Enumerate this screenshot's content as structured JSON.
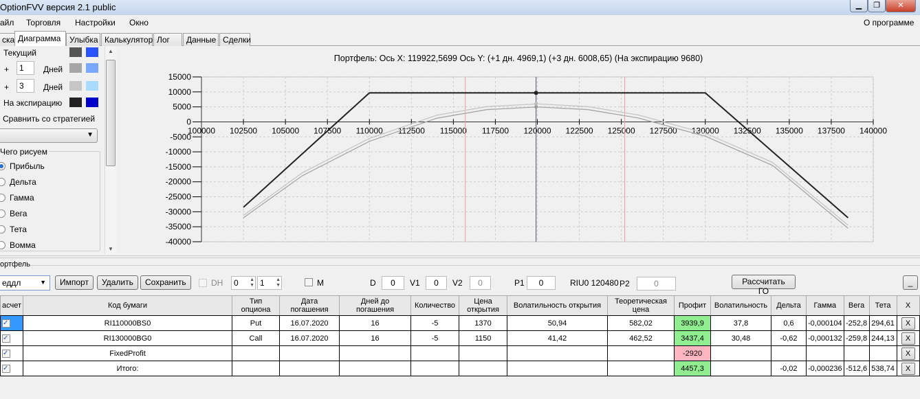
{
  "window": {
    "title": "OptionFVV версия 2.1 public",
    "minimize": "▁",
    "maximize": "❐",
    "close": "✕"
  },
  "menu": {
    "items": [
      "айл",
      "Торговля",
      "Настройки",
      "Окно"
    ],
    "about": "О программе"
  },
  "tabs": [
    "ска",
    "Диаграмма",
    "Улыбка",
    "Калькулятор",
    "Лог",
    "Данные",
    "Сделки"
  ],
  "left": {
    "current": "Текущий",
    "plus": "+",
    "days_label": "Дней",
    "day1": "1",
    "day3": "3",
    "expiry": "На экспирацию",
    "compare": "Сравнить со стратегией",
    "what_draw": "Чего рисуем",
    "radios": [
      "Прибыль",
      "Дельта",
      "Гамма",
      "Вега",
      "Тета",
      "Вомма"
    ],
    "colors": {
      "current": [
        "#555555",
        "#2a52fe"
      ],
      "d1": [
        "#a6a6a6",
        "#7aa8ff"
      ],
      "d3": [
        "#c6c6c6",
        "#a8dcff"
      ],
      "expiry": [
        "#222222",
        "#0000c8"
      ]
    }
  },
  "chart_data": {
    "type": "line",
    "title": "Портфель: Ось X: 119922,5699 Ось Y:  (+1 дн. 4969,1)  (+3 дн. 6008,65)  (На экспирацию 9680)",
    "xlim": [
      100000,
      140000
    ],
    "ylim": [
      -40000,
      15000
    ],
    "xticks": [
      "100000",
      "102500",
      "105000",
      "107500",
      "110000",
      "112500",
      "115000",
      "117500",
      "120000",
      "122500",
      "125000",
      "127500",
      "130000",
      "132500",
      "135000",
      "137500",
      "140000"
    ],
    "yticks": [
      "15000",
      "10000",
      "5000",
      "0",
      "-5000",
      "-10000",
      "-15000",
      "-20000",
      "-25000",
      "-30000",
      "-35000",
      "-40000"
    ],
    "series": [
      {
        "name": "На экспирацию",
        "color": "#222222",
        "points": [
          [
            102500,
            -28500
          ],
          [
            110000,
            9680
          ],
          [
            130000,
            9680
          ],
          [
            138500,
            -32000
          ]
        ]
      },
      {
        "name": "+3 дн.",
        "color": "#c6c6c6",
        "points": [
          [
            102500,
            -31200
          ],
          [
            106000,
            -17000
          ],
          [
            110000,
            -5500
          ],
          [
            114000,
            2200
          ],
          [
            117000,
            5100
          ],
          [
            120000,
            6008
          ],
          [
            123000,
            5100
          ],
          [
            126000,
            2300
          ],
          [
            130000,
            -3800
          ],
          [
            134000,
            -13500
          ],
          [
            138500,
            -34500
          ]
        ]
      },
      {
        "name": "+1 дн.",
        "color": "#a6a6a6",
        "points": [
          [
            102500,
            -32000
          ],
          [
            106000,
            -18000
          ],
          [
            110000,
            -6500
          ],
          [
            114000,
            1200
          ],
          [
            117000,
            4100
          ],
          [
            120000,
            4969
          ],
          [
            123000,
            4100
          ],
          [
            126000,
            1300
          ],
          [
            130000,
            -4800
          ],
          [
            134000,
            -14500
          ],
          [
            138500,
            -35500
          ]
        ]
      }
    ],
    "vlines": [
      {
        "x": 115700,
        "color": "#f4a0a0"
      },
      {
        "x": 125200,
        "color": "#f4a0a0"
      },
      {
        "x": 119922.57,
        "color": "#4a5070"
      }
    ],
    "marker": {
      "x": 119922.57,
      "y": 9680
    }
  },
  "portfolio": {
    "label": "ортфель",
    "strategy": "еддл",
    "import": "Импорт",
    "delete": "Удалить",
    "save": "Сохранить",
    "dh": "DH",
    "spin1": "0",
    "spin2": "1",
    "m": "M",
    "d_label": "D",
    "d": "0",
    "v1_label": "V1",
    "v1": "0",
    "v2_label": "V2",
    "v2": "0",
    "p1_label": "P1",
    "p1": "0",
    "riu": "RIU0 120480",
    "p2_label": "P2",
    "p2": "0",
    "calc": "Рассчитать ГО",
    "collapse": "_"
  },
  "table": {
    "headers": [
      "асчет",
      "Код бумаги",
      "Тип опциона",
      "Дата погашения",
      "Дней до погашения",
      "Количество",
      "Цена открытия",
      "Волатильность открытия",
      "Теоретическая цена",
      "Профит",
      "Волатильность",
      "Дельта",
      "Гамма",
      "Вега",
      "Тета",
      "X"
    ],
    "rows": [
      [
        "✓",
        "RI110000BS0",
        "Put",
        "16.07.2020",
        "16",
        "-5",
        "1370",
        "50,94",
        "582,02",
        "3939,9",
        "37,8",
        "0,6",
        "-0,000104",
        "-252,8",
        "294,61",
        "X"
      ],
      [
        "✓",
        "RI130000BG0",
        "Call",
        "16.07.2020",
        "16",
        "-5",
        "1150",
        "41,42",
        "462,52",
        "3437,4",
        "30,48",
        "-0,62",
        "-0,000132",
        "-259,8",
        "244,13",
        "X"
      ],
      [
        "✓",
        "FixedProfit",
        "",
        "",
        "",
        "",
        "",
        "",
        "",
        "-2920",
        "",
        "",
        "",
        "",
        "",
        "X"
      ],
      [
        "✓",
        "Итого:",
        "",
        "",
        "",
        "",
        "",
        "",
        "",
        "4457,3",
        "",
        "-0,02",
        "-0,000236",
        "-512,6",
        "538,74",
        "X"
      ]
    ]
  }
}
